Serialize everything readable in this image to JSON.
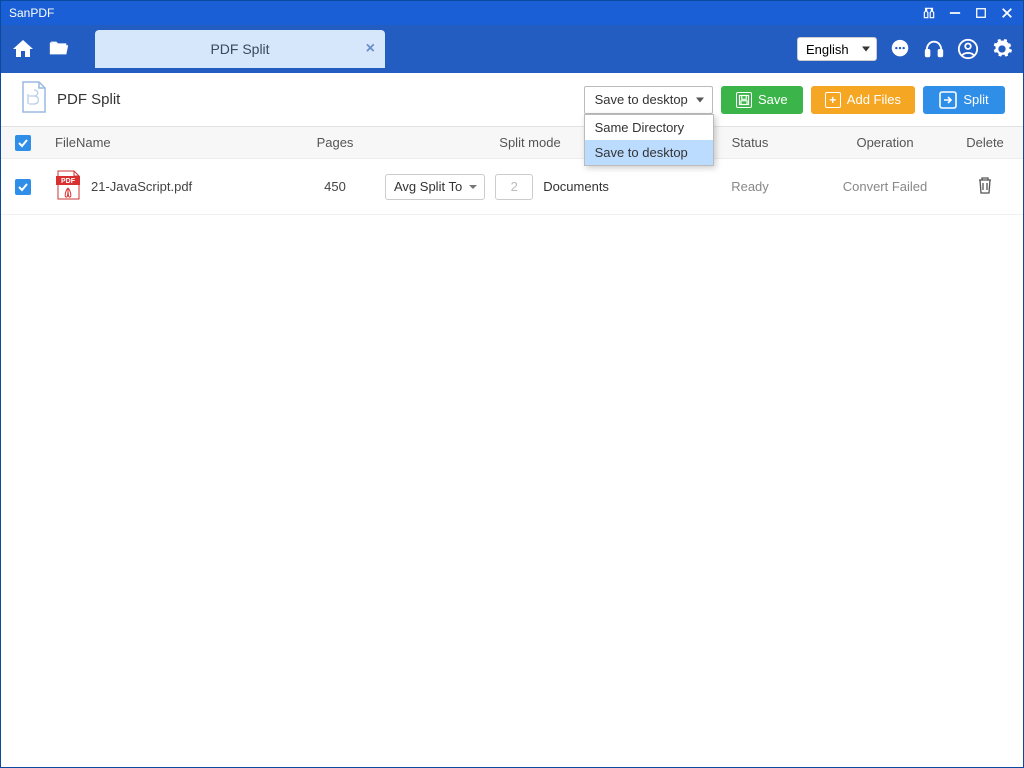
{
  "window": {
    "title": "SanPDF"
  },
  "header": {
    "tab_label": "PDF Split",
    "language": "English"
  },
  "toolbar": {
    "title": "PDF Split",
    "save_dropdown": {
      "selected": "Save to desktop",
      "options": [
        "Same Directory",
        "Save to desktop"
      ],
      "highlighted_index": 1
    },
    "save_button": "Save",
    "add_files_button": "Add Files",
    "split_button": "Split"
  },
  "table": {
    "headers": {
      "filename": "FileName",
      "pages": "Pages",
      "split_mode": "Split mode",
      "status": "Status",
      "operation": "Operation",
      "delete": "Delete"
    },
    "rows": [
      {
        "checked": true,
        "filename": "21-JavaScript.pdf",
        "pages": "450",
        "mode": "Avg Split To",
        "count": "2",
        "unit": "Documents",
        "status": "Ready",
        "operation": "Convert Failed"
      }
    ]
  }
}
